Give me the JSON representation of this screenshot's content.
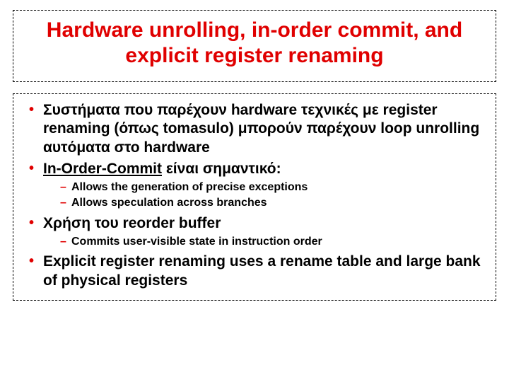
{
  "title": "Hardware unrolling, in-order commit, and explicit register renaming",
  "bullets": {
    "b1": "Συστήματα που παρέχουν hardware τεχνικές με register renaming (όπως tomasulo) μπορούν παρέχουν loop unrolling αυτόματα στο hardware",
    "b2_pre": "In-Order-Commit",
    "b2_post": " είναι σημαντικό:",
    "b2_sub1": "Allows the generation of precise exceptions",
    "b2_sub2": "Allows speculation across branches",
    "b3": "Χρήση του reorder buffer",
    "b3_sub1": "Commits user-visible state in instruction order",
    "b4": "Explicit register renaming uses a rename table and large bank of physical registers"
  }
}
